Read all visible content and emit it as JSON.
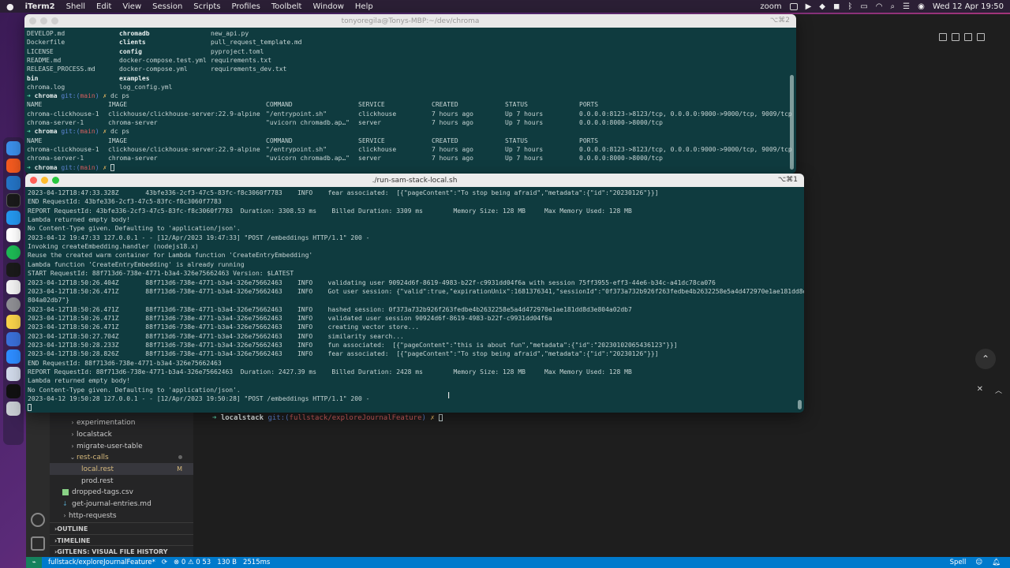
{
  "menubar": {
    "apple": "",
    "app": "iTerm2",
    "items": [
      "Shell",
      "Edit",
      "View",
      "Session",
      "Scripts",
      "Profiles",
      "Toolbelt",
      "Window",
      "Help"
    ],
    "zoom": "zoom",
    "datetime": "Wed 12 Apr  19:50"
  },
  "vscode": {
    "tree": [
      {
        "label": "experimentation",
        "type": "folder"
      },
      {
        "label": "localstack",
        "type": "folder"
      },
      {
        "label": "migrate-user-table",
        "type": "folder"
      },
      {
        "label": "rest-calls",
        "type": "folder-open",
        "color": "#d7ba7d"
      },
      {
        "label": "local.rest",
        "type": "file",
        "badge": "M",
        "color": "#d7ba7d"
      },
      {
        "label": "prod.rest",
        "type": "file"
      },
      {
        "label": "dropped-tags.csv",
        "type": "csv"
      },
      {
        "label": "get-journal-entries.md",
        "type": "md"
      },
      {
        "label": "http-requests",
        "type": "folder"
      }
    ],
    "sections": [
      "OUTLINE",
      "TIMELINE",
      "GITLENS: VISUAL FILE HISTORY"
    ],
    "terminal": {
      "arrow": "➜",
      "dir": "localstack",
      "git": "git:(",
      "branch": "fullstack/exploreJournalFeature",
      "close": ")",
      "x": "✗"
    },
    "status": {
      "branch": "fullstack/exploreJournalFeature*",
      "problems": "⊗ 0 ⚠ 0 53",
      "size": "130 B",
      "time": "2515ms",
      "spell": "Spell"
    }
  },
  "term1": {
    "title": "tonyoregila@Tonys-MBP:~/dev/chroma",
    "shortcut": "⌥⌘2",
    "ls": [
      [
        "DEVELOP.md",
        "chromadb",
        "new_api.py"
      ],
      [
        "Dockerfile",
        "clients",
        "pull_request_template.md"
      ],
      [
        "LICENSE",
        "config",
        "pyproject.toml"
      ],
      [
        "README.md",
        "docker-compose.test.yml",
        "requirements.txt"
      ],
      [
        "RELEASE_PROCESS.md",
        "docker-compose.yml",
        "requirements_dev.txt"
      ],
      [
        "bin",
        "examples",
        ""
      ],
      [
        "chroma.log",
        "log_config.yml",
        ""
      ]
    ],
    "prompt": {
      "arrow": "➜",
      "dir": "chroma",
      "git": "git:(",
      "branch": "main",
      "close": ")",
      "x": "✗",
      "cmd": "dc ps"
    },
    "ps_header": [
      "NAME",
      "IMAGE",
      "COMMAND",
      "SERVICE",
      "CREATED",
      "STATUS",
      "PORTS"
    ],
    "ps_rows": [
      [
        "chroma-clickhouse-1",
        "clickhouse/clickhouse-server:22.9-alpine",
        "\"/entrypoint.sh\"",
        "clickhouse",
        "7 hours ago",
        "Up 7 hours",
        "0.0.0.0:8123->8123/tcp, 0.0.0.0:9000->9000/tcp, 9009/tcp"
      ],
      [
        "chroma-server-1",
        "chroma-server",
        "\"uvicorn chromadb.ap…\"",
        "server",
        "7 hours ago",
        "Up 7 hours",
        "0.0.0.0:8000->8000/tcp"
      ]
    ]
  },
  "term2": {
    "title": "./run-sam-stack-local.sh",
    "shortcut": "⌥⌘1",
    "lines": [
      "2023-04-12T18:47:33.328Z       43bfe336-2cf3-47c5-83fc-f8c3060f7783    INFO    fear associated:  [{\"pageContent\":\"To stop being afraid\",\"metadata\":{\"id\":\"20230126\"}}]",
      "END RequestId: 43bfe336-2cf3-47c5-83fc-f8c3060f7783",
      "REPORT RequestId: 43bfe336-2cf3-47c5-83fc-f8c3060f7783  Duration: 3308.53 ms    Billed Duration: 3309 ms        Memory Size: 128 MB     Max Memory Used: 128 MB",
      "Lambda returned empty body!",
      "No Content-Type given. Defaulting to 'application/json'.",
      "2023-04-12 19:47:33 127.0.0.1 - - [12/Apr/2023 19:47:33] \"POST /embeddings HTTP/1.1\" 200 -",
      "Invoking createEmbedding.handler (nodejs18.x)",
      "Reuse the created warm container for Lambda function 'CreateEntryEmbedding'",
      "Lambda function 'CreateEntryEmbedding' is already running",
      "START RequestId: 88f713d6-738e-4771-b3a4-326e75662463 Version: $LATEST",
      "2023-04-12T18:50:26.404Z       88f713d6-738e-4771-b3a4-326e75662463    INFO    validating user 90924d6f-8619-4983-b22f-c9931dd04f6a with session 75ff3955-eff3-44e6-b34c-a41dc78ca076",
      "2023-04-12T18:50:26.471Z       88f713d6-738e-4771-b3a4-326e75662463    INFO    Got user session: {\"valid\":true,\"expirationUnix\":1681376341,\"sessionId\":\"0f373a732b926f263fedbe4b2632258e5a4d472970e1ae181dd8d3e",
      "804a02db7\"}",
      "2023-04-12T18:50:26.471Z       88f713d6-738e-4771-b3a4-326e75662463    INFO    hashed session: 0f373a732b926f263fedbe4b2632258e5a4d472970e1ae181dd8d3e804a02db7",
      "2023-04-12T18:50:26.471Z       88f713d6-738e-4771-b3a4-326e75662463    INFO    validated user session 90924d6f-8619-4983-b22f-c9931dd04f6a",
      "2023-04-12T18:50:26.471Z       88f713d6-738e-4771-b3a4-326e75662463    INFO    creating vector store...",
      "2023-04-12T18:50:27.704Z       88f713d6-738e-4771-b3a4-326e75662463    INFO    similarity search...",
      "2023-04-12T18:50:28.233Z       88f713d6-738e-4771-b3a4-326e75662463    INFO    fun associated:  [{\"pageContent\":\"this is about fun\",\"metadata\":{\"id\":\"20230102065436123\"}}]",
      "2023-04-12T18:50:28.826Z       88f713d6-738e-4771-b3a4-326e75662463    INFO    fear associated:  [{\"pageContent\":\"To stop being afraid\",\"metadata\":{\"id\":\"20230126\"}}]",
      "END RequestId: 88f713d6-738e-4771-b3a4-326e75662463",
      "REPORT RequestId: 88f713d6-738e-4771-b3a4-326e75662463  Duration: 2427.39 ms    Billed Duration: 2428 ms        Memory Size: 128 MB     Max Memory Used: 128 MB",
      "Lambda returned empty body!",
      "No Content-Type given. Defaulting to 'application/json'.",
      "2023-04-12 19:50:28 127.0.0.1 - - [12/Apr/2023 19:50:28] \"POST /embeddings HTTP/1.1\" 200 -"
    ]
  }
}
